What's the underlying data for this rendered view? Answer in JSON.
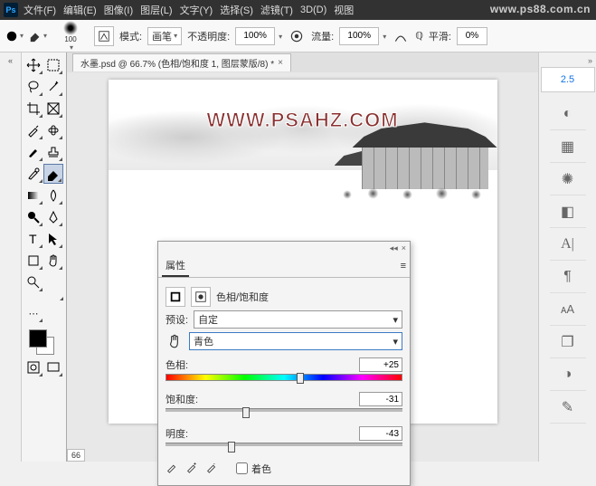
{
  "menubar": {
    "items": [
      "文件(F)",
      "编辑(E)",
      "图像(I)",
      "图层(L)",
      "文字(Y)",
      "选择(S)",
      "滤镜(T)",
      "3D(D)",
      "视图"
    ]
  },
  "corner_watermark": "www.ps88.com.cn",
  "optionsbar": {
    "brush_size": "100",
    "mode_label": "模式:",
    "mode_value": "画笔",
    "opacity_label": "不透明度:",
    "opacity_value": "100%",
    "flow_label": "流量:",
    "flow_value": "100%",
    "smooth_label": "平滑:",
    "smooth_value": "0%"
  },
  "tab": {
    "title": "水墨.psd @ 66.7% (色相/饱和度 1, 图层蒙版/8) *"
  },
  "canvas": {
    "watermark": "WWW.PSAHZ.COM"
  },
  "status": {
    "zoom": "66"
  },
  "right": {
    "value": "2.5"
  },
  "panel": {
    "title": "属性",
    "adjustment": "色相/饱和度",
    "preset_label": "预设:",
    "preset_value": "自定",
    "channel_value": "青色",
    "hue_label": "色相:",
    "hue_value": "+25",
    "sat_label": "饱和度:",
    "sat_value": "-31",
    "light_label": "明度:",
    "light_value": "-43",
    "colorize_label": "着色"
  }
}
